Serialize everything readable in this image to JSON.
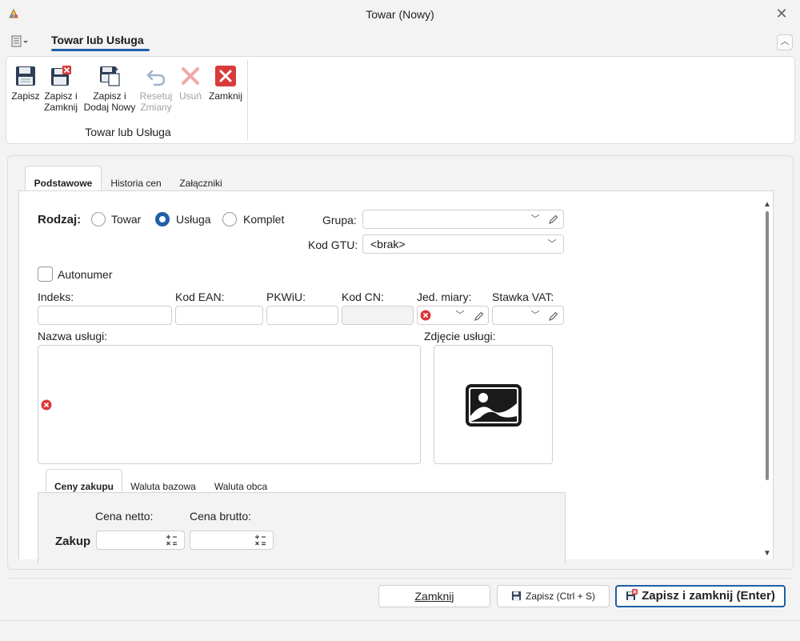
{
  "window": {
    "title": "Towar (Nowy)"
  },
  "ribbon": {
    "tab_label": "Towar lub Usługa",
    "group_label": "Towar lub Usługa",
    "buttons": [
      {
        "line1": "Zapisz",
        "line2": "",
        "enabled": true
      },
      {
        "line1": "Zapisz i",
        "line2": "Zamknij",
        "enabled": true
      },
      {
        "line1": "Zapisz i",
        "line2": "Dodaj Nowy",
        "enabled": true
      },
      {
        "line1": "Resetuj",
        "line2": "Zmiany",
        "enabled": false
      },
      {
        "line1": "Usuń",
        "line2": "",
        "enabled": false
      },
      {
        "line1": "Zamknij",
        "line2": "",
        "enabled": true
      }
    ]
  },
  "tabs": [
    {
      "label": "Podstawowe",
      "active": true
    },
    {
      "label": "Historia cen",
      "active": false
    },
    {
      "label": "Załączniki",
      "active": false
    }
  ],
  "form": {
    "rodzaj_label": "Rodzaj:",
    "rodzaj_options": [
      {
        "label": "Towar",
        "selected": false
      },
      {
        "label": "Usługa",
        "selected": true
      },
      {
        "label": "Komplet",
        "selected": false
      }
    ],
    "grupa_label": "Grupa:",
    "grupa_value": "",
    "kod_gtu_label": "Kod GTU:",
    "kod_gtu_value": "<brak>",
    "autonumer_label": "Autonumer",
    "autonumer_checked": false,
    "indeks_label": "Indeks:",
    "kod_ean_label": "Kod EAN:",
    "pkwiu_label": "PKWiU:",
    "kod_cn_label": "Kod CN:",
    "jed_miary_label": "Jed. miary:",
    "stawka_vat_label": "Stawka VAT:",
    "nazwa_label": "Nazwa usługi:",
    "zdjecie_label": "Zdjęcie usługi:"
  },
  "price_tabs": [
    {
      "label": "Ceny zakupu",
      "active": true
    },
    {
      "label": "Waluta bazowa",
      "active": false
    },
    {
      "label": "Waluta obca",
      "active": false
    }
  ],
  "prices": {
    "cena_netto_label": "Cena netto:",
    "cena_brutto_label": "Cena brutto:",
    "zakup_label": "Zakup",
    "netto_value": "",
    "brutto_value": ""
  },
  "footer": {
    "close_label": "Zamknij",
    "save_label": "Zapisz (Ctrl + S)",
    "save_close_label": "Zapisz i zamknij (Enter)"
  },
  "colors": {
    "accent": "#1f5fa8",
    "error": "#d93a3a",
    "window_bg": "#f3f3f3"
  },
  "icons": {
    "save": "floppy-disk-icon",
    "save_close": "floppy-disk-close-icon",
    "save_add": "floppy-disk-add-icon",
    "reset": "undo-icon",
    "delete": "x-icon",
    "close": "close-square-icon",
    "image": "image-placeholder-icon",
    "calc": "calculator-icon",
    "error": "error-circle-icon",
    "edit": "pencil-icon"
  }
}
